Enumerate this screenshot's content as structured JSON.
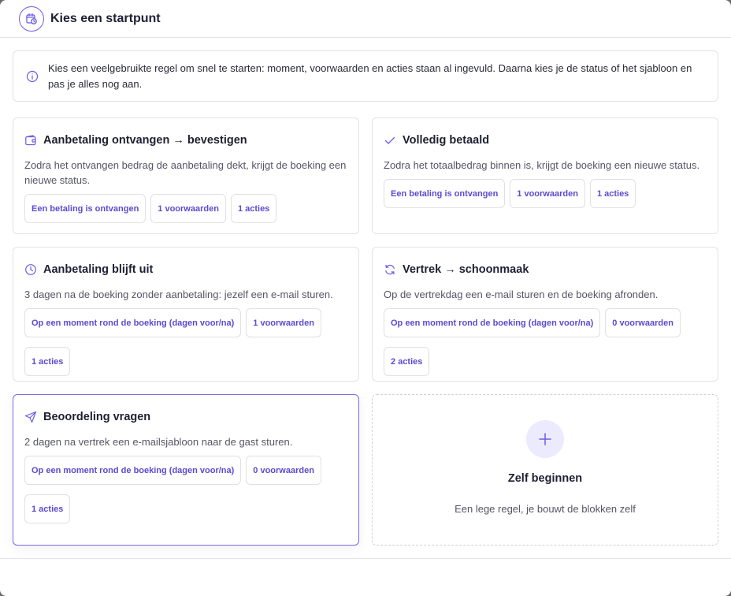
{
  "header": {
    "title": "Kies een startpunt",
    "icon": "calendar-clock-icon"
  },
  "info": {
    "icon": "info-icon",
    "text": "Kies een veelgebruikte regel om snel te starten: moment, voorwaarden en acties staan al ingevuld. Daarna kies je de status of het sjabloon en pas je alles nog aan."
  },
  "templates": [
    {
      "icon": "wallet-icon",
      "title": "Aanbetaling ontvangen → bevestigen",
      "description": "Zodra het ontvangen bedrag de aanbetaling dekt, krijgt de boeking een nieuwe status.",
      "trigger": "Een betaling is ontvangen",
      "conditions": "1 voorwaarden",
      "actions": "1 acties"
    },
    {
      "icon": "check-icon",
      "title": "Volledig betaald",
      "description": "Zodra het totaalbedrag binnen is, krijgt de boeking een nieuwe status.",
      "trigger": "Een betaling is ontvangen",
      "conditions": "1 voorwaarden",
      "actions": "1 acties"
    },
    {
      "icon": "clock-icon",
      "title": "Aanbetaling blijft uit",
      "description": "3 dagen na de boeking zonder aanbetaling: jezelf een e-mail sturen.",
      "trigger": "Op een moment rond de boeking (dagen voor/na)",
      "conditions": "1 voorwaarden",
      "actions": "1 acties"
    },
    {
      "icon": "refresh-icon",
      "title": "Vertrek → schoonmaak",
      "description": "Op de vertrekdag een e-mail sturen en de boeking afronden.",
      "trigger": "Op een moment rond de boeking (dagen voor/na)",
      "conditions": "0 voorwaarden",
      "actions": "2 acties"
    },
    {
      "icon": "send-icon",
      "title": "Beoordeling vragen",
      "description": "2 dagen na vertrek een e-mailsjabloon naar de gast sturen.",
      "trigger": "Op een moment rond de boeking (dagen voor/na)",
      "conditions": "0 voorwaarden",
      "actions": "1 acties",
      "selected": true
    }
  ],
  "blank": {
    "icon": "plus-icon",
    "title": "Zelf beginnen",
    "subtitle": "Een lege regel, je bouwt de blokken zelf"
  },
  "colors": {
    "accent": "#5b4bd0",
    "accent_light": "#eceafd",
    "border": "#e3e3e8"
  }
}
